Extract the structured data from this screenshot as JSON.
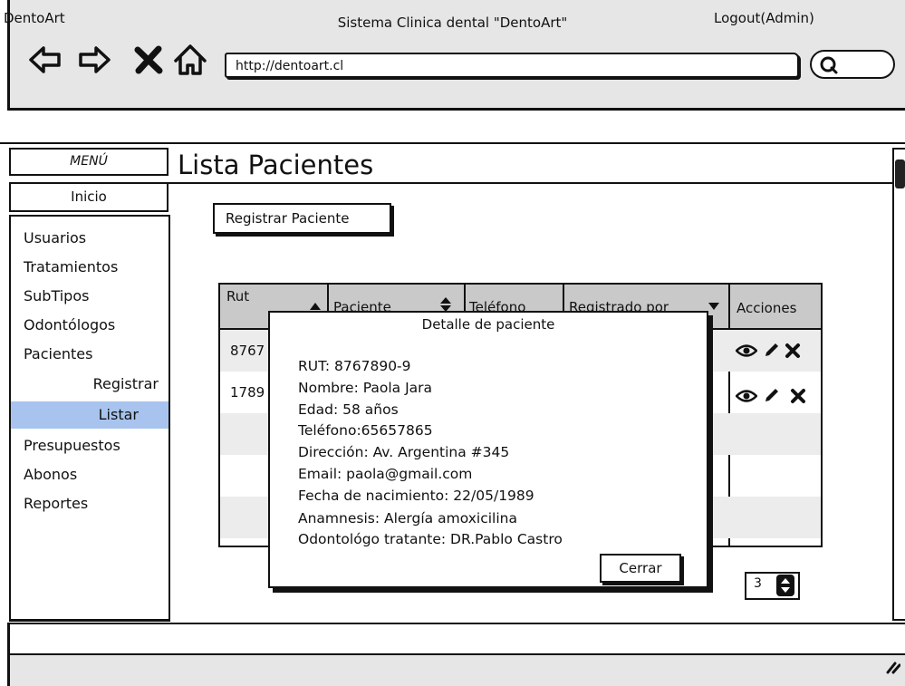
{
  "browser": {
    "window_title": "Sistema Clinica dental \"DentoArt\"",
    "url": "http://dentoart.cl"
  },
  "topbar": {
    "brand": "DentoArt",
    "logout": "Logout(Admin)"
  },
  "sidebar": {
    "menu_label": "MENÚ",
    "home": "Inicio",
    "items": [
      "Usuarios",
      "Tratamientos",
      "SubTipos",
      "Odontólogos",
      "Pacientes",
      "Registrar",
      "Listar",
      "Presupuestos",
      "Abonos",
      "Reportes"
    ],
    "active": "Listar"
  },
  "main": {
    "title": "Lista Pacientes",
    "register_button": "Registrar Paciente",
    "table": {
      "headers": [
        "Rut",
        "Paciente",
        "Teléfono",
        "Registrado por",
        "Acciones"
      ],
      "rows": [
        {
          "rut": "8767"
        },
        {
          "rut": "1789"
        }
      ]
    },
    "pager": {
      "value": "3"
    }
  },
  "modal": {
    "title": "Detalle de paciente",
    "lines": [
      "RUT: 8767890-9",
      "Nombre: Paola Jara",
      "Edad: 58 años",
      "Teléfono:65657865",
      "Dirección: Av. Argentina #345",
      "Email: paola@gmail.com",
      "Fecha de nacimiento: 22/05/1989",
      "Anamnesis: Alergía amoxicilina",
      "Odontológo tratante: DR.Pablo Castro"
    ],
    "close_button": "Cerrar"
  },
  "icons": {
    "back": "back-arrow-icon",
    "forward": "forward-arrow-icon",
    "stop": "stop-x-icon",
    "home": "home-icon",
    "search": "search-icon",
    "view": "eye-icon",
    "edit": "pencil-icon",
    "delete": "x-icon"
  },
  "colors": {
    "active_nav": "#a8c4ee",
    "table_header": "#c9c9c9",
    "chrome": "#e6e6e6"
  }
}
